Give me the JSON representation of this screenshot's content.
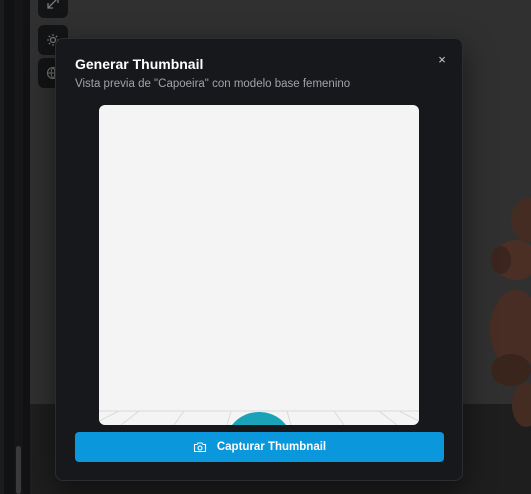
{
  "modal": {
    "title": "Generar Thumbnail",
    "subtitle": "Vista previa de \"Capoeira\" con modelo base femenino",
    "close_icon": "×",
    "capture_button_label": "Capturar Thumbnail"
  },
  "colors": {
    "accent": "#0a97db",
    "modal_bg": "#17181c",
    "preview_bg": "#f4f4f4",
    "model_teal": "#1aa3b8"
  },
  "icons": {
    "close": "close-icon",
    "camera": "camera-icon",
    "expand": "expand-icon",
    "sun": "sun-icon",
    "globe": "globe-icon"
  }
}
